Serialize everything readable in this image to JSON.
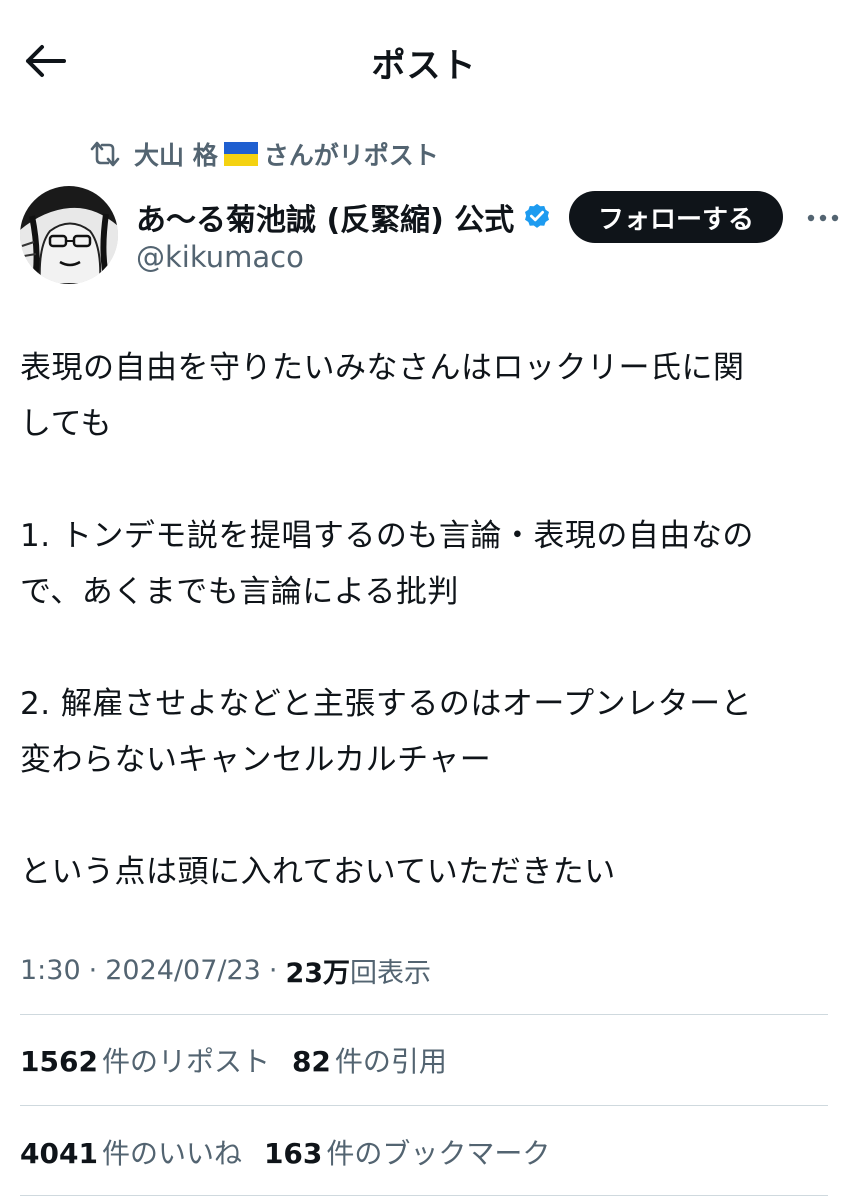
{
  "header": {
    "title": "ポスト",
    "back_icon": "arrow-left-icon"
  },
  "repost": {
    "icon": "repost-icon",
    "user": "大山 格",
    "flag": "ukraine-flag-emoji",
    "suffix": "さんがリポスト"
  },
  "author": {
    "display_name": "あ〜る菊池誠 (反緊縮) 公式",
    "handle": "@kikumaco",
    "verified": true
  },
  "follow_label": "フォローする",
  "more_icon": "more-horizontal-icon",
  "tweet": {
    "lines": [
      "表現の自由を守りたいみなさんはロックリー氏に関",
      "しても",
      "",
      "1. トンデモ説を提唱するのも言論・表現の自由なの",
      "で、あくまでも言論による批判",
      "",
      "2. 解雇させよなどと主張するのはオープンレターと",
      "変わらないキャンセルカルチャー",
      "",
      "という点は頭に入れておいていただきたい"
    ]
  },
  "meta": {
    "time": "1:30",
    "date": "2024/07/23",
    "views_count": "23万",
    "views_label": "回表示",
    "separator": "·"
  },
  "stats": {
    "reposts": {
      "count": "1562",
      "label": "件のリポスト"
    },
    "quotes": {
      "count": "82",
      "label": "件の引用"
    },
    "likes": {
      "count": "4041",
      "label": "件のいいね"
    },
    "bookmarks": {
      "count": "163",
      "label": "件のブックマーク"
    }
  },
  "colors": {
    "text": "#0f1419",
    "secondary": "#536471",
    "verified_blue": "#1d9bf0",
    "button_dark": "#0f1419",
    "divider": "#cfd9de",
    "flag_blue": "#1f5fd0",
    "flag_yellow": "#f4d211"
  }
}
